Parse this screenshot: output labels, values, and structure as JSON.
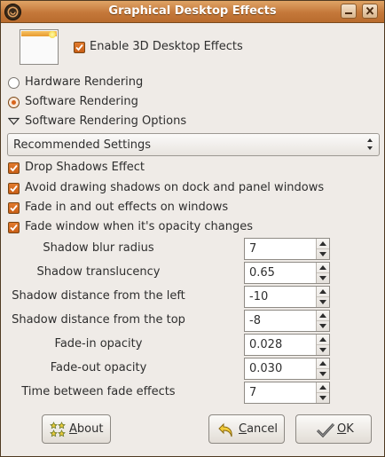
{
  "window": {
    "title": "Graphical Desktop Effects"
  },
  "header": {
    "enable_label": "Enable 3D Desktop Effects",
    "enable_checked": true
  },
  "rendering": {
    "hardware_label": "Hardware Rendering",
    "software_label": "Software Rendering",
    "selected": "software",
    "options_label": "Software Rendering Options"
  },
  "preset": {
    "value": "Recommended Settings"
  },
  "options": [
    {
      "label": "Drop Shadows Effect",
      "checked": true
    },
    {
      "label": "Avoid drawing shadows on dock and panel windows",
      "checked": true
    },
    {
      "label": "Fade in and out effects on windows",
      "checked": true
    },
    {
      "label": "Fade window when it's opacity changes",
      "checked": true
    }
  ],
  "spinners": [
    {
      "label": "Shadow blur radius",
      "value": "7"
    },
    {
      "label": "Shadow translucency",
      "value": "0.65"
    },
    {
      "label": "Shadow distance from the left",
      "value": "-10"
    },
    {
      "label": "Shadow distance from the top",
      "value": "-8"
    },
    {
      "label": "Fade-in opacity",
      "value": "0.028"
    },
    {
      "label": "Fade-out opacity",
      "value": "0.030"
    },
    {
      "label": "Time between fade effects",
      "value": "7"
    }
  ],
  "buttons": {
    "about": {
      "mnemonic": "A",
      "rest": "bout"
    },
    "cancel": {
      "mnemonic": "C",
      "rest": "ancel"
    },
    "ok": {
      "mnemonic": "O",
      "rest": "K"
    }
  },
  "icons": {
    "window_menu": "app-menu-icon",
    "minimize": "minimize-icon",
    "close": "close-icon",
    "about": "about-icon",
    "cancel": "undo-arrow-icon",
    "ok": "check-icon"
  },
  "colors": {
    "titlebar": "#c4783a",
    "accent": "#d9641a",
    "background": "#efebe7"
  }
}
